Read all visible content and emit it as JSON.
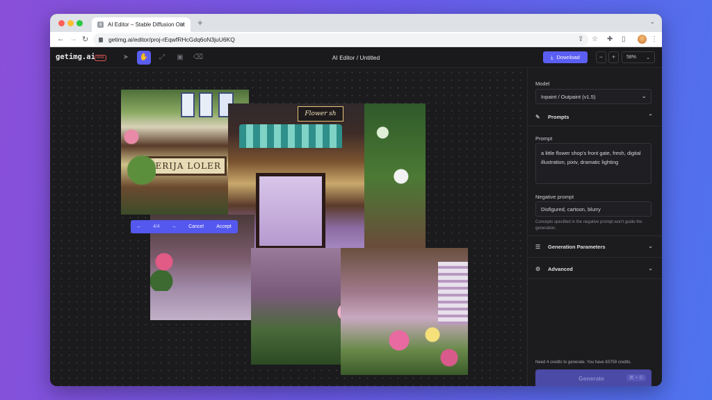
{
  "browser": {
    "tab_title": "AI Editor – Stable Diffusion Out",
    "tab_favicon": "g",
    "url": "getimg.ai/editor/proj-rEqwfRHcGdq6oN3juU6KQ",
    "controls": {
      "close": "#ff5f57",
      "minimize": "#febc2e",
      "maximize": "#28c840"
    }
  },
  "app": {
    "logo": "getimg.ai",
    "beta": "beta",
    "title": "AI Editor / Untitled",
    "download_label": "Download",
    "zoom": "58%",
    "zoom_out": "−",
    "zoom_in": "+",
    "tools": [
      "select-tool-icon",
      "hand-tool-icon",
      "expand-tool-icon",
      "image-tool-icon",
      "eraser-tool-icon"
    ],
    "accent": "#5b5ef2"
  },
  "canvas": {
    "page": "4/4",
    "cancel": "Cancel",
    "accept": "Accept",
    "shop_sign": "FERIJA LOLER",
    "hanging_sign": "Flower sh"
  },
  "panel": {
    "model_label": "Model",
    "model_value": "Inpaint / Outpaint (v1.5)",
    "prompts_header": "Prompts",
    "prompt_label": "Prompt",
    "prompt_value": "a little flower shop's front gate, fresh, digital illustration, pixiv, dramatic lighting",
    "neg_label": "Negative prompt",
    "neg_value": "Disfigured, cartoon, blurry",
    "neg_hint": "Concepts specified in the negative prompt won't guide the generation.",
    "gen_params": "Generation Parameters",
    "advanced": "Advanced",
    "credits": "Need 4 credits to generate. You have 83759 credits.",
    "generate": "Generate",
    "shortcut": "⌘ + G"
  }
}
